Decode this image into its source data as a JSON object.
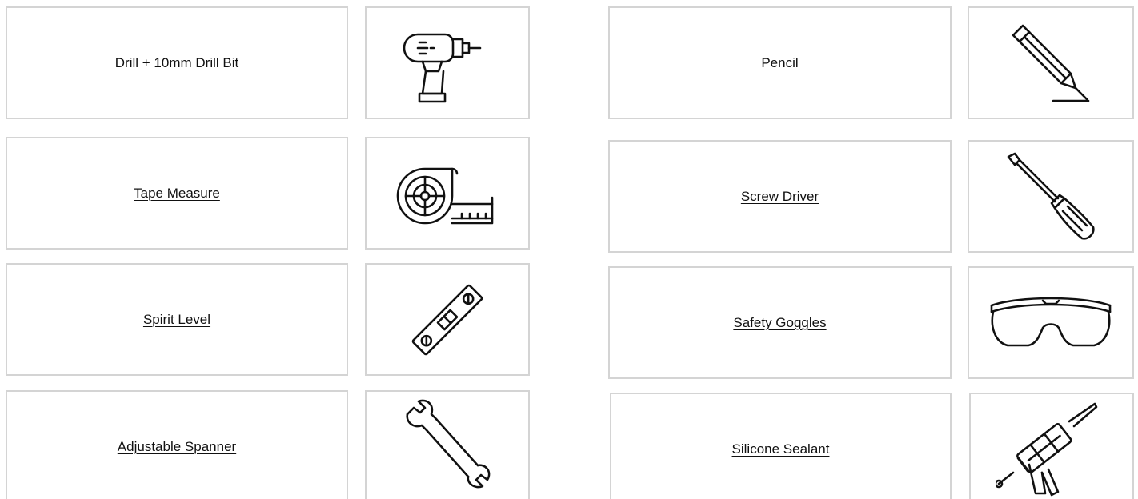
{
  "tools": {
    "left": [
      {
        "label": "Drill + 10mm Drill Bit",
        "icon": "drill-icon"
      },
      {
        "label": "Tape Measure",
        "icon": "tape-measure-icon"
      },
      {
        "label": "Spirit Level",
        "icon": "spirit-level-icon"
      },
      {
        "label": "Adjustable Spanner",
        "icon": "spanner-icon"
      }
    ],
    "right": [
      {
        "label": "Pencil",
        "icon": "pencil-icon"
      },
      {
        "label": "Screw Driver",
        "icon": "screwdriver-icon"
      },
      {
        "label": "Safety Goggles",
        "icon": "safety-goggles-icon"
      },
      {
        "label": "Silicone Sealant",
        "icon": "silicone-gun-icon"
      }
    ]
  },
  "colors": {
    "border": "#d4d4d4",
    "text": "#111111",
    "icon_stroke": "#111111",
    "background": "#ffffff"
  }
}
